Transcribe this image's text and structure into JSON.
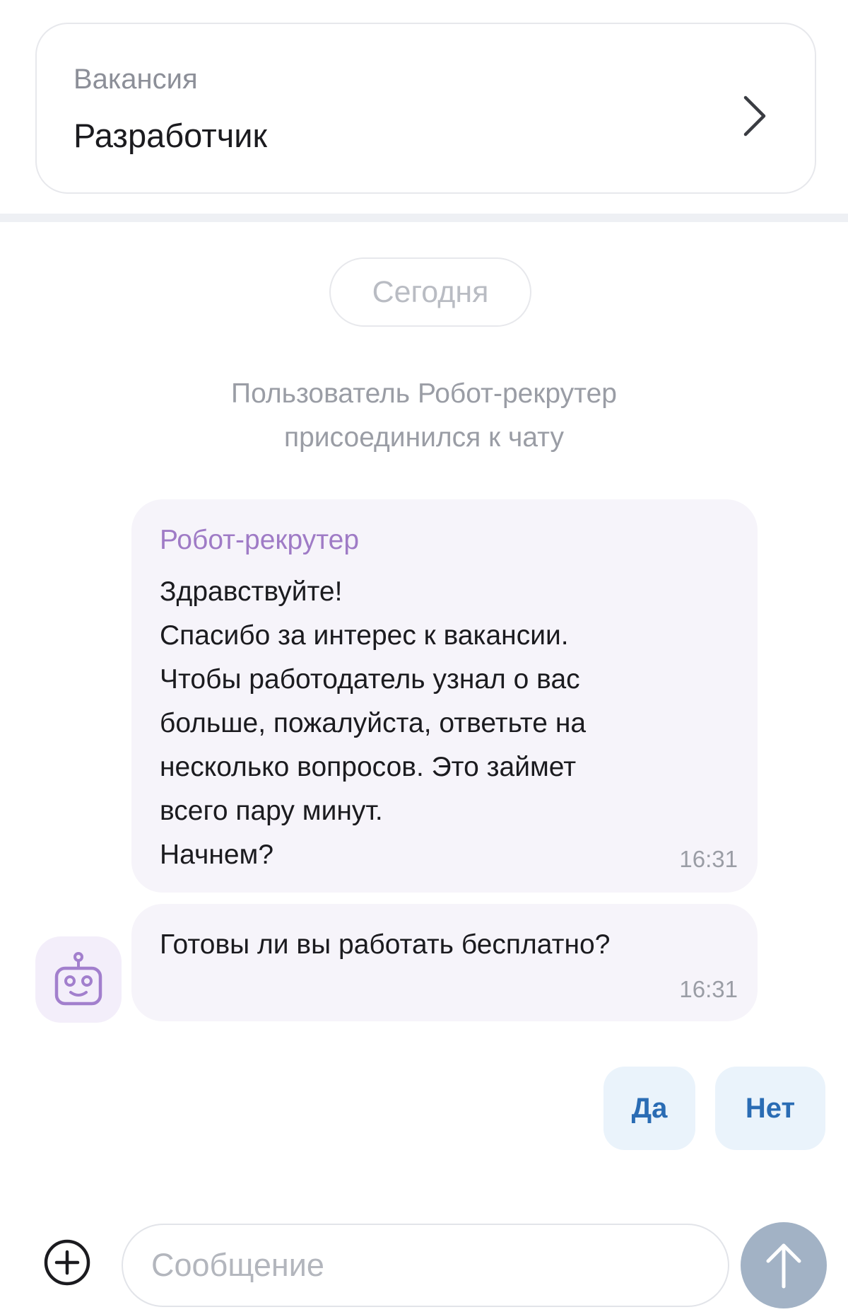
{
  "vacancy": {
    "label": "Вакансия",
    "title": "Разработчик",
    "chevron_icon": "chevron-right-icon"
  },
  "chat": {
    "date_separator": "Сегодня",
    "system_message": {
      "lines": [
        "Пользователь Робот-рекрутер",
        "присоединился к чату"
      ]
    },
    "messages": [
      {
        "sender": "Робот-рекрутер",
        "lines": [
          "Здравствуйте!",
          "Спасибо за интерес к вакансии.",
          "Чтобы работодатель узнал о вас",
          "больше, пожалуйста, ответьте на",
          "несколько вопросов. Это займет",
          "всего пару минут.",
          "Начнем?"
        ],
        "time": "16:31"
      },
      {
        "text": "Готовы ли вы работать бесплатно?",
        "time": "16:31"
      }
    ],
    "avatar_icon": "robot-icon",
    "quick_replies": [
      "Да",
      "Нет"
    ]
  },
  "composer": {
    "placeholder": "Сообщение",
    "value": "",
    "add_icon": "plus-circle-icon",
    "send_icon": "arrow-up-icon"
  },
  "colors": {
    "accent_purple": "#9f7bc6",
    "bubble_bg": "#f6f4fa",
    "reply_button_bg": "#eaf3fb",
    "reply_button_text": "#2a6cb4",
    "send_button": "#a2b2c5"
  }
}
